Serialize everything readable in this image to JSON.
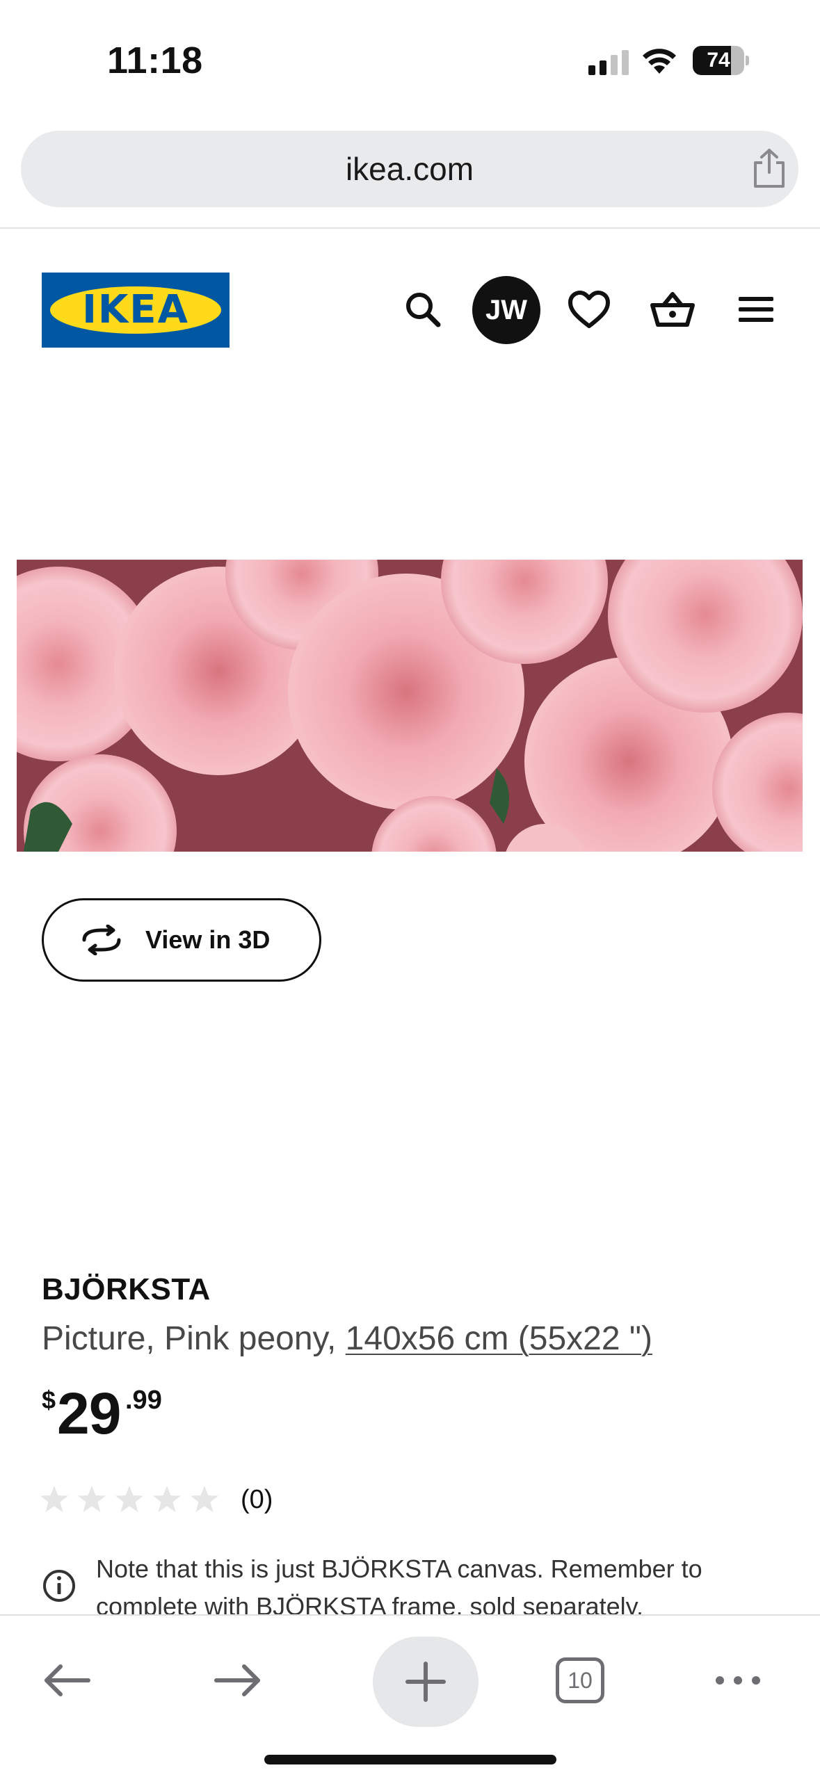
{
  "status_bar": {
    "time": "11:18",
    "battery": "74",
    "battery_level": 0.74,
    "icons": [
      "cellular-signal-icon",
      "wifi-icon",
      "battery-icon"
    ]
  },
  "browser": {
    "url": "ikea.com",
    "share_icon": "share-icon"
  },
  "header": {
    "logo_text": "IKEA",
    "avatar_initials": "JW",
    "icons": [
      "search-icon",
      "heart-icon",
      "shopping-basket-icon",
      "hamburger-menu-icon"
    ],
    "colors": {
      "logo_blue": "#0058a3",
      "logo_yellow": "#ffda1a"
    }
  },
  "product": {
    "image_alt": "Pink peony picture",
    "view_3d_label": "View in 3D",
    "name": "BJÖRKSTA",
    "description_prefix": "Picture, Pink peony, ",
    "size_link": "140x56 cm (55x22 \")",
    "price": {
      "currency": "$",
      "integer": "29",
      "decimal": ".99"
    },
    "rating": {
      "stars": 0,
      "max_stars": 5,
      "count": "(0)"
    },
    "note": "Note that this is just BJÖRKSTA canvas. Remember to complete with BJÖRKSTA frame, sold separately."
  },
  "toolbar": {
    "tabs_count": "10",
    "icons": [
      "back-arrow-icon",
      "forward-arrow-icon",
      "plus-icon",
      "tabs-icon",
      "more-icon"
    ]
  }
}
